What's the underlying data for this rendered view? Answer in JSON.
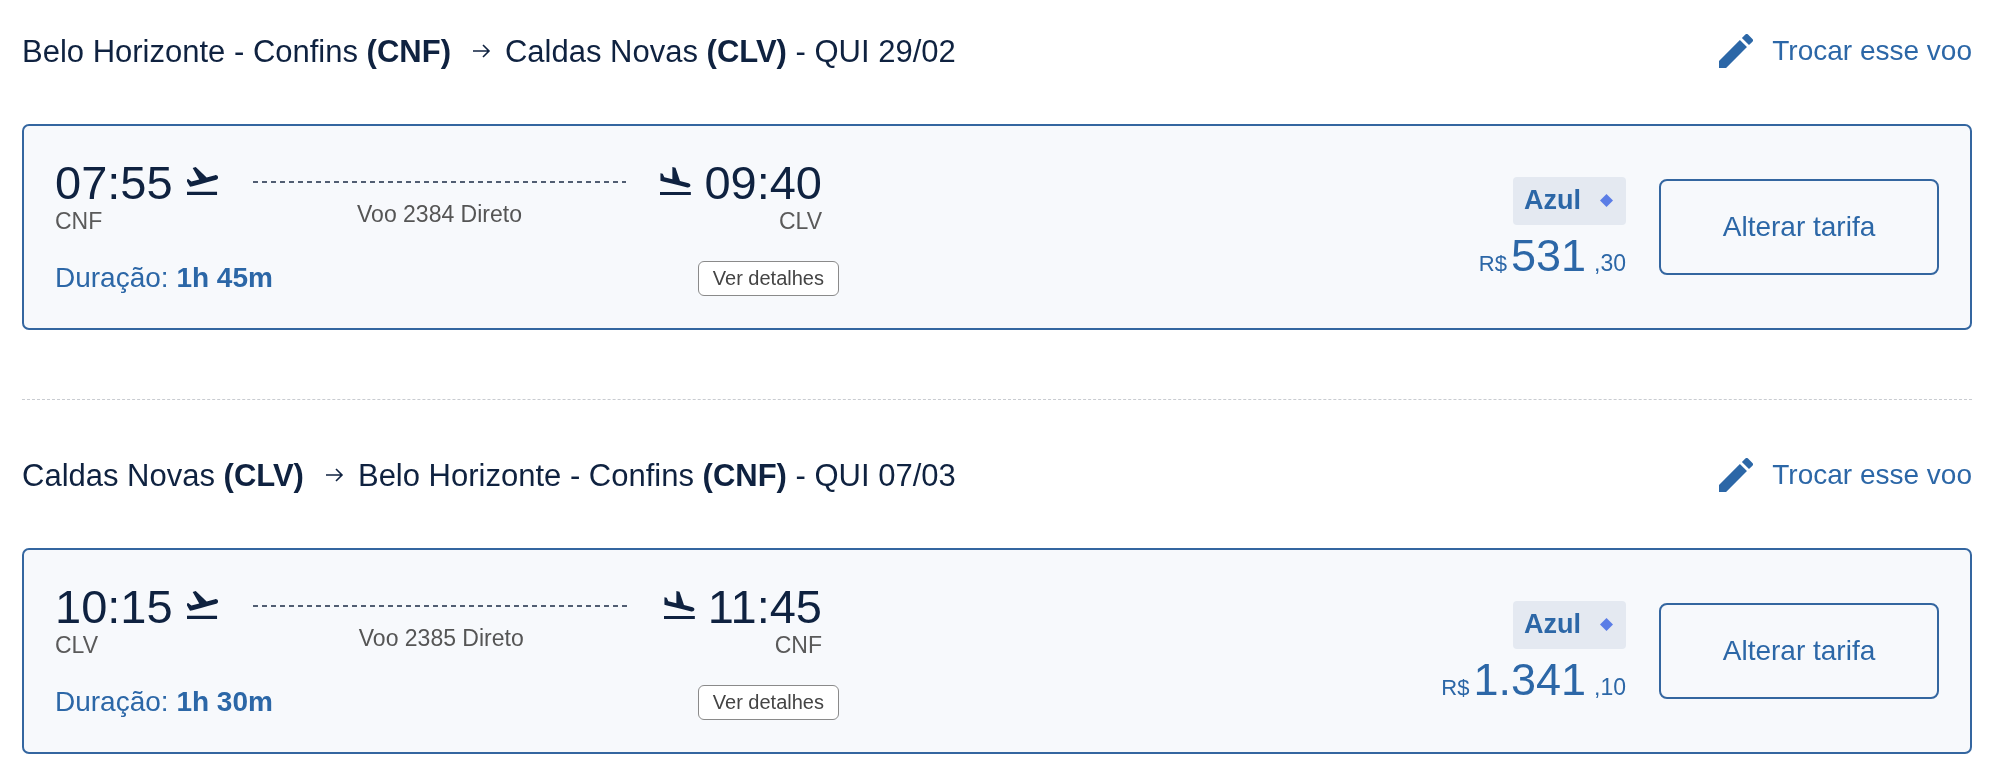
{
  "flights": [
    {
      "route": {
        "origin": "Belo Horizonte - Confins **(CNF)**",
        "destination": "Caldas Novas **(CLV)** - QUI 29/02"
      },
      "change_link": "Trocar esse voo",
      "departure": {
        "time": "07:55",
        "airport": "CNF"
      },
      "arrival": {
        "time": "09:40",
        "airport": "CLV"
      },
      "flight_info": "Voo 2384 Direto",
      "duration": "Duração: **1h 45m**",
      "details_button": "Ver detalhes",
      "airline": "Azul",
      "price": {
        "currency": "R$",
        "amount": "531",
        "cents": ",30"
      },
      "fare_button": "Alterar tarifa"
    },
    {
      "route": {
        "origin": "Caldas Novas **(CLV)**",
        "destination": "Belo Horizonte - Confins **(CNF)** - QUI 07/03"
      },
      "change_link": "Trocar esse voo",
      "departure": {
        "time": "10:15",
        "airport": "CLV"
      },
      "arrival": {
        "time": "11:45",
        "airport": "CNF"
      },
      "flight_info": "Voo 2385 Direto",
      "duration": "Duração: **1h 30m**",
      "details_button": "Ver detalhes",
      "airline": "Azul",
      "price": {
        "currency": "R$",
        "amount": "1.341",
        "cents": ",10"
      },
      "fare_button": "Alterar tarifa"
    }
  ]
}
